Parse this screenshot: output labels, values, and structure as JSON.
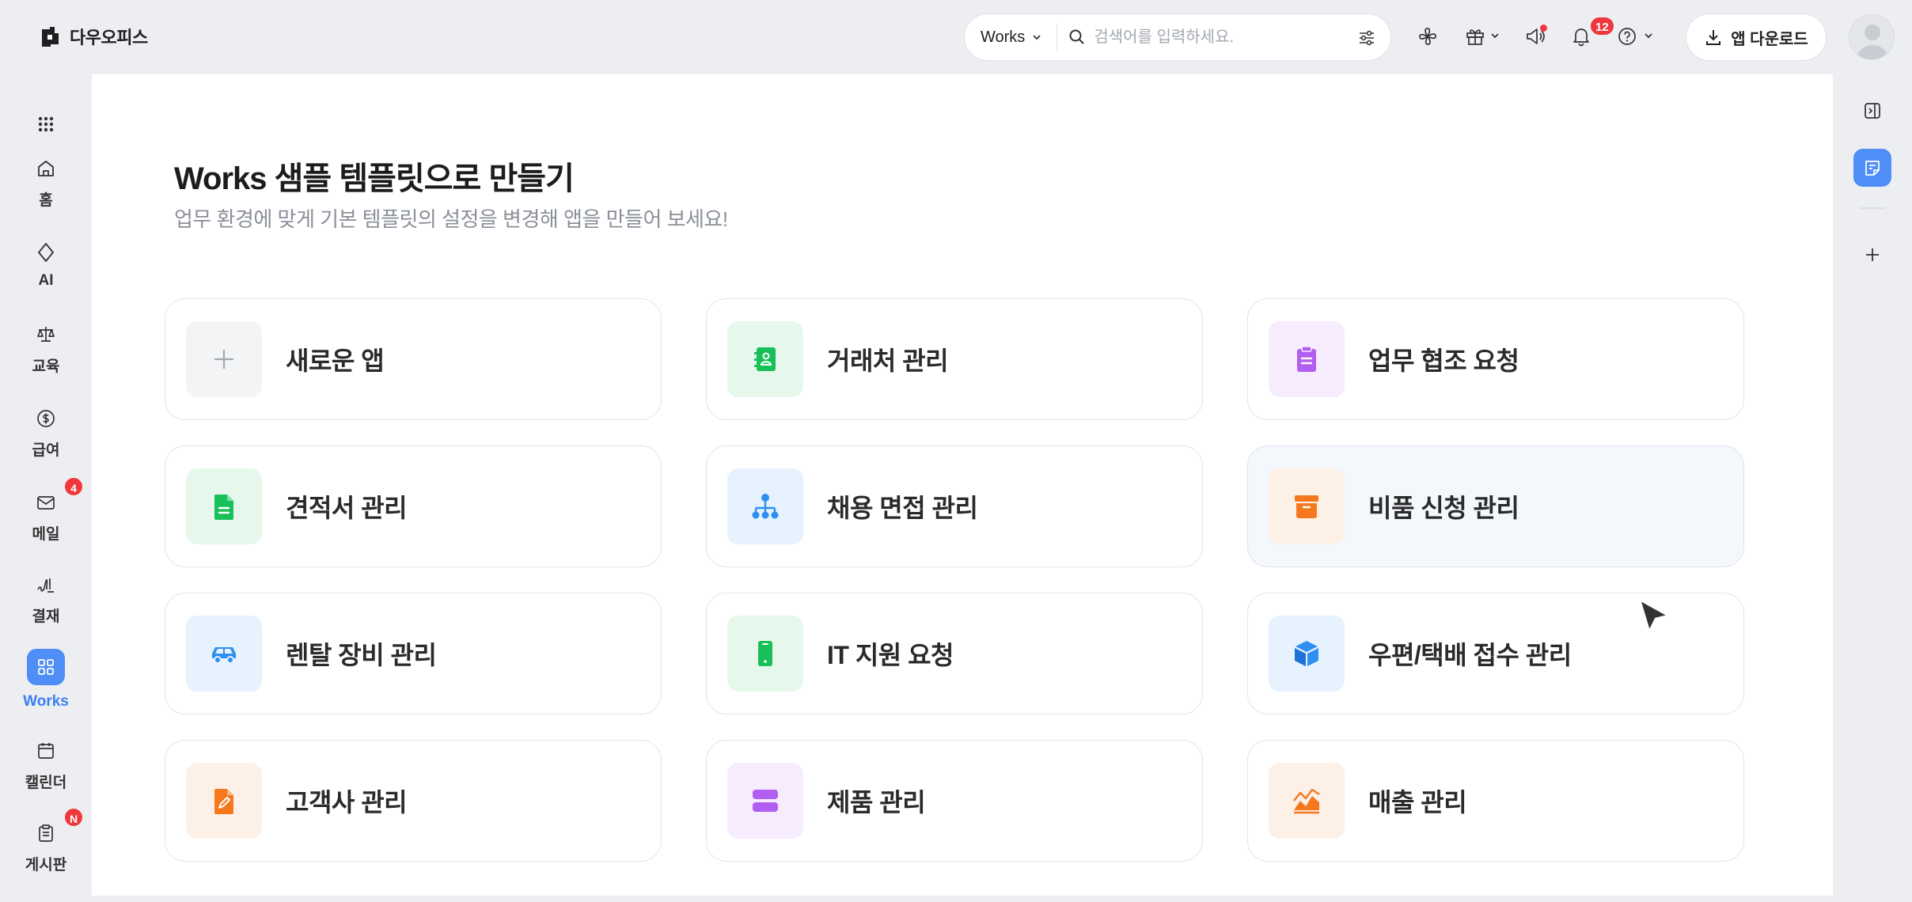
{
  "brand": {
    "name": "다우오피스"
  },
  "search": {
    "scope": "Works",
    "placeholder": "검색어를 입력하세요."
  },
  "header": {
    "notification_count": "12",
    "download_label": "앱 다운로드"
  },
  "sidebar": {
    "items": [
      {
        "label": "",
        "icon": "apps-grid-icon"
      },
      {
        "label": "홈",
        "icon": "home-icon"
      },
      {
        "label": "AI",
        "icon": "diamond-icon"
      },
      {
        "label": "교육",
        "icon": "scale-icon"
      },
      {
        "label": "급여",
        "icon": "dollar-icon"
      },
      {
        "label": "메일",
        "icon": "mail-icon",
        "badge": "4"
      },
      {
        "label": "결재",
        "icon": "signature-icon"
      },
      {
        "label": "Works",
        "icon": "works-grid-icon",
        "active": true
      },
      {
        "label": "캘린더",
        "icon": "calendar-icon"
      },
      {
        "label": "게시판",
        "icon": "clipboard-icon",
        "badge": "N"
      }
    ]
  },
  "main": {
    "title": "Works 샘플 템플릿으로 만들기",
    "subtitle": "업무 환경에 맞게 기본 템플릿의 설정을 변경해 앱을 만들어 보세요!",
    "cards": [
      {
        "label": "새로운 앱",
        "icon": "plus-icon",
        "tile_color": "#f3f4f6",
        "icon_color": "#a3a7ad"
      },
      {
        "label": "거래처 관리",
        "icon": "contact-book-icon",
        "tile_color": "#e6f8ec",
        "icon_color": "#19c05a"
      },
      {
        "label": "업무 협조 요청",
        "icon": "clipboard-list-icon",
        "tile_color": "#f6ecfd",
        "icon_color": "#b25ef0"
      },
      {
        "label": "견적서 관리",
        "icon": "document-icon",
        "tile_color": "#e6f8ec",
        "icon_color": "#19c05a"
      },
      {
        "label": "채용 면접 관리",
        "icon": "org-chart-icon",
        "tile_color": "#e6f2fd",
        "icon_color": "#2f8ff0"
      },
      {
        "label": "비품 신청 관리",
        "icon": "archive-box-icon",
        "tile_color": "#fdf0e6",
        "icon_color": "#f5781f"
      },
      {
        "label": "렌탈 장비 관리",
        "icon": "car-icon",
        "tile_color": "#e6f2fd",
        "icon_color": "#2f8ff0"
      },
      {
        "label": "IT 지원 요청",
        "icon": "phone-icon",
        "tile_color": "#e6f8ec",
        "icon_color": "#19c05a"
      },
      {
        "label": "우편/택배 접수 관리",
        "icon": "cube-icon",
        "tile_color": "#e6f2fd",
        "icon_color": "#2f8ff0"
      },
      {
        "label": "고객사 관리",
        "icon": "edit-document-icon",
        "tile_color": "#fdf0e6",
        "icon_color": "#f5781f"
      },
      {
        "label": "제품 관리",
        "icon": "stack-icon",
        "tile_color": "#f6ecfd",
        "icon_color": "#b25ef0"
      },
      {
        "label": "매출 관리",
        "icon": "area-chart-icon",
        "tile_color": "#fdf0e6",
        "icon_color": "#f5781f"
      }
    ]
  }
}
